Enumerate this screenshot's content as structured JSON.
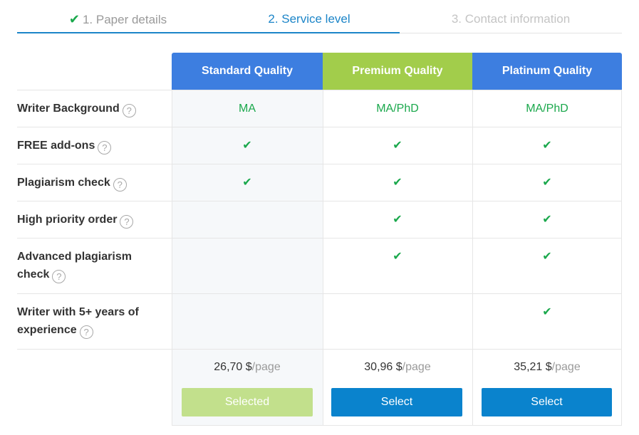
{
  "steps": [
    {
      "label": "1. Paper details",
      "check": "✔"
    },
    {
      "label": "2. Service level"
    },
    {
      "label": "3. Contact information"
    }
  ],
  "plans": [
    {
      "name": "Standard Quality",
      "price": "26,70 $",
      "unit": "/page",
      "button": "Selected",
      "color": "#3d7ee0"
    },
    {
      "name": "Premium Quality",
      "price": "30,96 $",
      "unit": "/page",
      "button": "Select",
      "color": "#a2cd4b"
    },
    {
      "name": "Platinum Quality",
      "price": "35,21 $",
      "unit": "/page",
      "button": "Select",
      "color": "#3d7ee0"
    }
  ],
  "help_glyph": "?",
  "rows": [
    {
      "label_lines": [
        "Writer Background"
      ],
      "values": [
        "MA",
        "MA/PhD",
        "MA/PhD"
      ]
    },
    {
      "label_lines": [
        "FREE add-ons"
      ],
      "values": [
        "✔",
        "✔",
        "✔"
      ]
    },
    {
      "label_lines": [
        "Plagiarism check"
      ],
      "values": [
        "✔",
        "✔",
        "✔"
      ]
    },
    {
      "label_lines": [
        "High priority order"
      ],
      "values": [
        "",
        "✔",
        "✔"
      ]
    },
    {
      "label_lines": [
        "Advanced plagiarism",
        "check"
      ],
      "values": [
        "",
        "✔",
        "✔"
      ]
    },
    {
      "label_lines": [
        "Writer with 5+ years of",
        "experience"
      ],
      "values": [
        "",
        "",
        "✔"
      ]
    }
  ],
  "colors": {
    "accent": "#1c85c8",
    "check": "#1aa84c",
    "button": "#0a83cd",
    "selected_button": "#c2e08c"
  }
}
